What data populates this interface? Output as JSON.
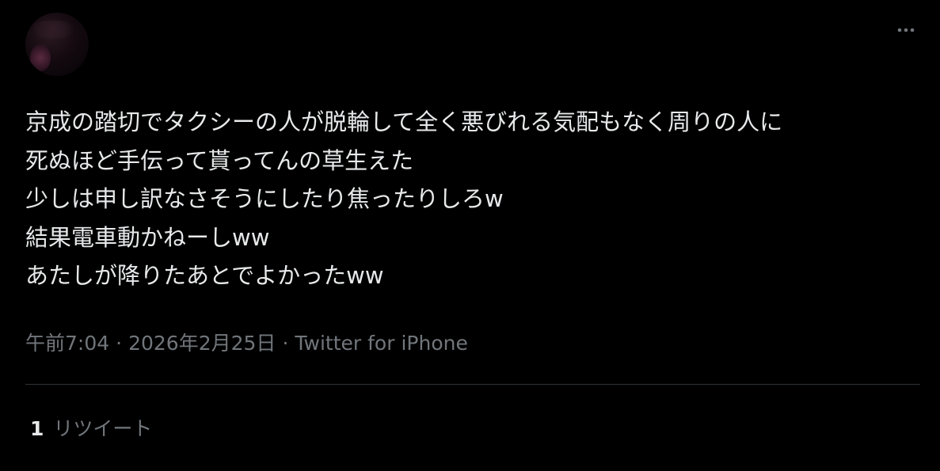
{
  "author": {
    "display_name": "",
    "handle": ""
  },
  "tweet": {
    "lines": [
      "京成の踏切でタクシーの人が脱輪して全く悪びれる気配もなく周りの人に",
      "死ぬほど手伝って貰ってんの草生えた",
      "少しは申し訳なさそうにしたり焦ったりしろw",
      "結果電車動かねーしww",
      "あたしが降りたあとでよかったww"
    ],
    "time": "午前7:04",
    "date": "2026年2月25日",
    "separator": "·",
    "source": "Twitter for iPhone"
  },
  "stats": {
    "retweet_count": "1",
    "retweet_label": "リツイート"
  },
  "icons": {
    "more": "more-horizontal-icon"
  },
  "colors": {
    "background": "#000000",
    "text": "#e7e9ea",
    "secondary_text": "#71767b",
    "divider": "#2f3336"
  }
}
